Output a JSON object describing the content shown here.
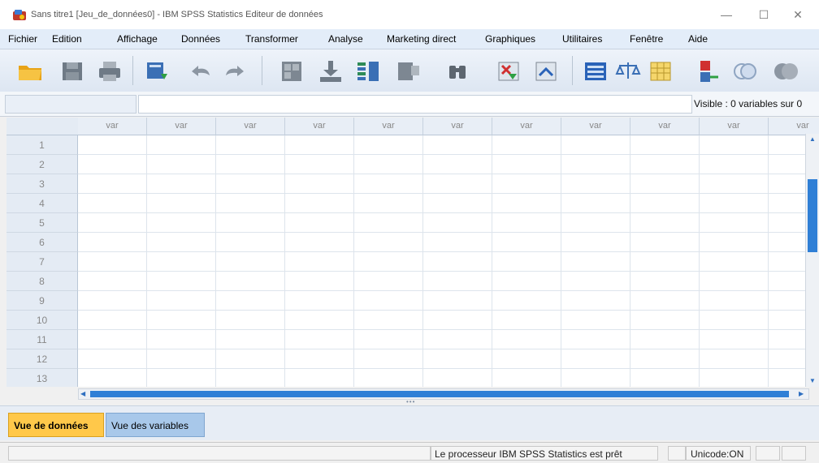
{
  "window": {
    "title": "Sans titre1 [Jeu_de_données0] - IBM SPSS Statistics Editeur de données",
    "minimize": "—",
    "maximize": "☐",
    "close": "✕"
  },
  "menu": [
    "Fichier",
    "Edition",
    "Affichage",
    "Données",
    "Transformer",
    "Analyse",
    "Marketing direct",
    "Graphiques",
    "Utilitaires",
    "Fenêtre",
    "Aide"
  ],
  "toolbar_icons": [
    "open-folder-icon",
    "save-icon",
    "print-icon",
    "recall-dialog-icon",
    "undo-icon",
    "redo-icon",
    "goto-case-icon",
    "goto-variable-icon",
    "variables-icon",
    "run-descriptives-icon",
    "find-icon",
    "insert-cases-icon",
    "insert-variable-icon",
    "split-file-icon",
    "weight-cases-icon",
    "select-cases-icon",
    "value-labels-icon",
    "use-sets-icon",
    "show-all-variables-icon"
  ],
  "editor": {
    "cell_name": "",
    "cell_value": "",
    "visible_label": "Visible : 0 variables sur 0"
  },
  "grid": {
    "column_label": "var",
    "column_count": 11,
    "row_labels": [
      "1",
      "2",
      "3",
      "4",
      "5",
      "6",
      "7",
      "8",
      "9",
      "10",
      "11",
      "12",
      "13"
    ]
  },
  "tabs": {
    "data_view": "Vue de données",
    "variable_view": "Vue des variables"
  },
  "status": {
    "processor": "Le processeur IBM SPSS Statistics  est prêt",
    "unicode": "Unicode:ON"
  },
  "colors": {
    "active_tab": "#ffc84a",
    "inactive_tab": "#a8c8ea",
    "scrollbar_thumb": "#2f7fd6",
    "menubar": "#e3edf9"
  }
}
